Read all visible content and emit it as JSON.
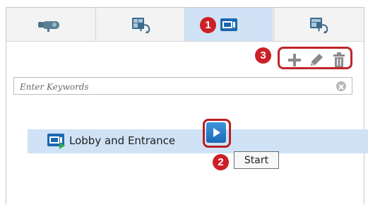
{
  "tabs": [
    {
      "name": "camera",
      "icon": "camera-icon"
    },
    {
      "name": "view",
      "icon": "view-refresh-icon"
    },
    {
      "name": "tour",
      "icon": "tour-monitor-icon",
      "selected": true
    },
    {
      "name": "schedule",
      "icon": "monitor-refresh-icon"
    }
  ],
  "badges": {
    "one": "1",
    "two": "2",
    "three": "3"
  },
  "toolbar": {
    "add_icon": "plus-icon",
    "edit_icon": "pencil-icon",
    "delete_icon": "trash-icon"
  },
  "search": {
    "placeholder": "Enter Keywords"
  },
  "list": [
    {
      "label": "Lobby and Entrance",
      "icon": "tour-icon",
      "selected": true
    }
  ],
  "tooltip": {
    "text": "Start"
  },
  "colors": {
    "accent": "#cfe2f6",
    "annotation": "#cc1f26",
    "button": "#2a7ac6"
  }
}
